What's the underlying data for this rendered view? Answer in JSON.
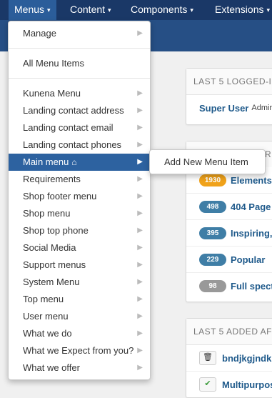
{
  "topnav": {
    "items": [
      {
        "label": "Menus",
        "caret": "▾"
      },
      {
        "label": "Content",
        "caret": "▾"
      },
      {
        "label": "Components",
        "caret": "▾"
      },
      {
        "label": "Extensions",
        "caret": "▾"
      }
    ]
  },
  "menus_dropdown": {
    "manage": "Manage",
    "all_items": "All Menu Items",
    "items": [
      "Kunena Menu",
      "Landing contact address",
      "Landing contact email",
      "Landing contact phones",
      "Main menu",
      "Requirements",
      "Shop footer menu",
      "Shop menu",
      "Shop top phone",
      "Social Media",
      "Support menus",
      "System Menu",
      "Top menu",
      "User menu",
      "What we do",
      "What we Expect from you?",
      "What we offer"
    ],
    "selected": "Main menu",
    "home_icon": "home-icon",
    "arrow_glyph": "▶"
  },
  "submenu": {
    "add_new": "Add New Menu Item"
  },
  "modules": {
    "logged_in": {
      "title": "LAST 5 LOGGED-I",
      "rows": [
        {
          "name": "Super User",
          "role": "Admir"
        }
      ]
    },
    "popular": {
      "title": "R A",
      "rows": [
        {
          "count": "1930",
          "title": "Elements",
          "color": "#f0a21a"
        },
        {
          "count": "498",
          "title": "404 Page",
          "color": "#3f7ea6"
        },
        {
          "count": "395",
          "title": "Inspiring,",
          "color": "#3f7ea6"
        },
        {
          "count": "229",
          "title": "Popular",
          "color": "#3f7ea6"
        },
        {
          "count": "98",
          "title": "Full spectru",
          "color": "#999999"
        }
      ]
    },
    "added": {
      "title": "LAST 5 ADDED AF",
      "rows": [
        {
          "icon": "trash-icon",
          "glyph": "🗑",
          "title": "bndjkgjndk"
        },
        {
          "icon": "check-icon",
          "glyph": "✔",
          "title": "Multipurpos"
        }
      ]
    }
  }
}
